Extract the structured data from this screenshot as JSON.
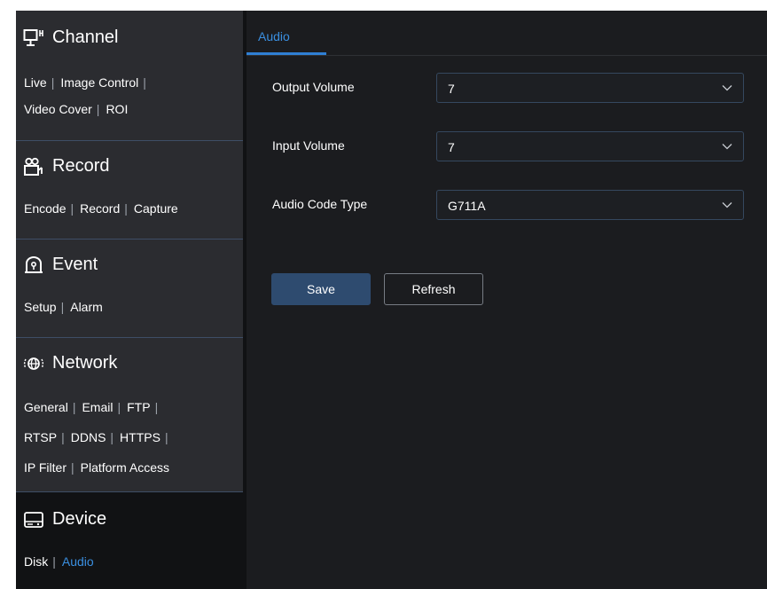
{
  "sidebar": {
    "channel": {
      "title": "Channel",
      "icon": "monitor-icon",
      "links": [
        "Live",
        "Image Control",
        "Video Cover",
        "ROI"
      ]
    },
    "record": {
      "title": "Record",
      "icon": "camera-icon",
      "links": [
        "Encode",
        "Record",
        "Capture"
      ]
    },
    "event": {
      "title": "Event",
      "icon": "alarm-icon",
      "links": [
        "Setup",
        "Alarm"
      ]
    },
    "network": {
      "title": "Network",
      "icon": "globe-icon",
      "links": [
        "General",
        "Email",
        "FTP",
        "RTSP",
        "DDNS",
        "HTTPS",
        "IP Filter",
        "Platform Access"
      ]
    },
    "device": {
      "title": "Device",
      "icon": "device-icon",
      "links": [
        "Disk",
        "Audio"
      ],
      "selected": "Audio"
    }
  },
  "main": {
    "tab": "Audio",
    "fields": {
      "output_volume": {
        "label": "Output Volume",
        "value": "7"
      },
      "input_volume": {
        "label": "Input Volume",
        "value": "7"
      },
      "audio_code_type": {
        "label": "Audio Code Type",
        "value": "G711A"
      }
    },
    "buttons": {
      "save": "Save",
      "refresh": "Refresh"
    }
  },
  "colors": {
    "accent": "#3a8fe0",
    "sidebar_bg": "#2b2c30",
    "main_bg": "#1b1c1f",
    "save_bg": "#2e4b6f"
  }
}
